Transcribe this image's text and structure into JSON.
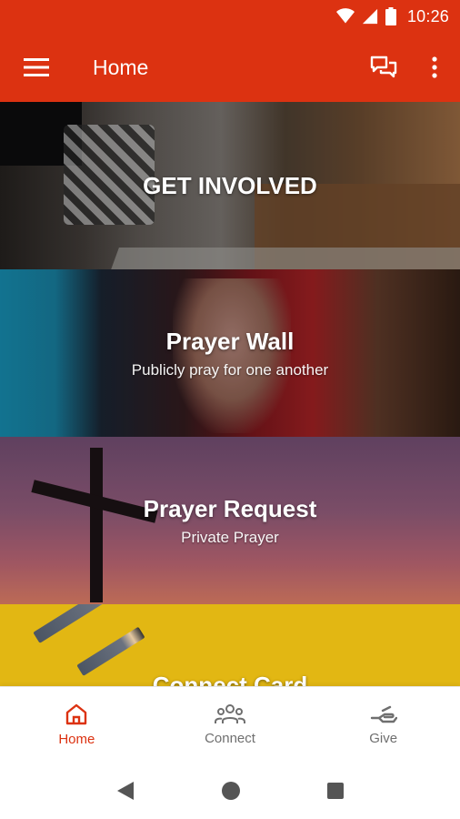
{
  "status_bar": {
    "time": "10:26"
  },
  "app_bar": {
    "title": "Home"
  },
  "cards": [
    {
      "title": "GET INVOLVED",
      "subtitle": ""
    },
    {
      "title": "Prayer Wall",
      "subtitle": "Publicly pray for one another"
    },
    {
      "title": "Prayer Request",
      "subtitle": "Private Prayer"
    },
    {
      "title": "Connect Card",
      "subtitle": ""
    }
  ],
  "bottom_nav": {
    "items": [
      {
        "label": "Home",
        "icon": "home-icon",
        "active": true
      },
      {
        "label": "Connect",
        "icon": "people-icon",
        "active": false
      },
      {
        "label": "Give",
        "icon": "hand-give-icon",
        "active": false
      }
    ]
  },
  "colors": {
    "brand": "#dc3211",
    "inactive": "#6f6f6f"
  }
}
